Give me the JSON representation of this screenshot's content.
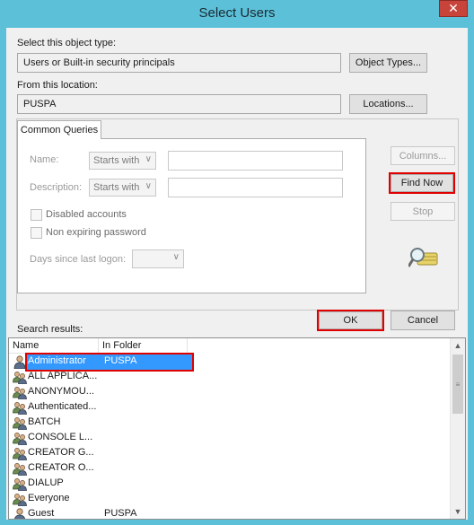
{
  "window": {
    "title": "Select Users",
    "close_glyph": "✕"
  },
  "object_type": {
    "label": "Select this object type:",
    "value": "Users or Built-in security principals",
    "button": "Object Types..."
  },
  "location": {
    "label": "From this location:",
    "value": "PUSPA",
    "button": "Locations..."
  },
  "queries": {
    "tab": "Common Queries",
    "name_label": "Name:",
    "name_mode": "Starts with",
    "description_label": "Description:",
    "description_mode": "Starts with",
    "disabled_accounts": "Disabled accounts",
    "non_expiring": "Non expiring password",
    "days_label": "Days since last logon:"
  },
  "side_buttons": {
    "columns": "Columns...",
    "find_now": "Find Now",
    "stop": "Stop"
  },
  "dialog_buttons": {
    "ok": "OK",
    "cancel": "Cancel"
  },
  "results": {
    "label": "Search results:",
    "columns": [
      "Name",
      "In Folder"
    ],
    "rows": [
      {
        "name": "Administrator",
        "folder": "PUSPA",
        "icon": "user-icon",
        "selected": true
      },
      {
        "name": "ALL APPLICA...",
        "folder": "",
        "icon": "group-icon"
      },
      {
        "name": "ANONYMOU...",
        "folder": "",
        "icon": "group-icon"
      },
      {
        "name": "Authenticated...",
        "folder": "",
        "icon": "group-icon"
      },
      {
        "name": "BATCH",
        "folder": "",
        "icon": "group-icon"
      },
      {
        "name": "CONSOLE L...",
        "folder": "",
        "icon": "group-icon"
      },
      {
        "name": "CREATOR G...",
        "folder": "",
        "icon": "group-icon"
      },
      {
        "name": "CREATOR O...",
        "folder": "",
        "icon": "group-icon"
      },
      {
        "name": "DIALUP",
        "folder": "",
        "icon": "group-icon"
      },
      {
        "name": "Everyone",
        "folder": "",
        "icon": "group-icon"
      },
      {
        "name": "Guest",
        "folder": "PUSPA",
        "icon": "user-icon"
      }
    ]
  },
  "colors": {
    "title_bar": "#5cc0d8",
    "highlight": "#e00000",
    "selection": "#3399ff"
  }
}
